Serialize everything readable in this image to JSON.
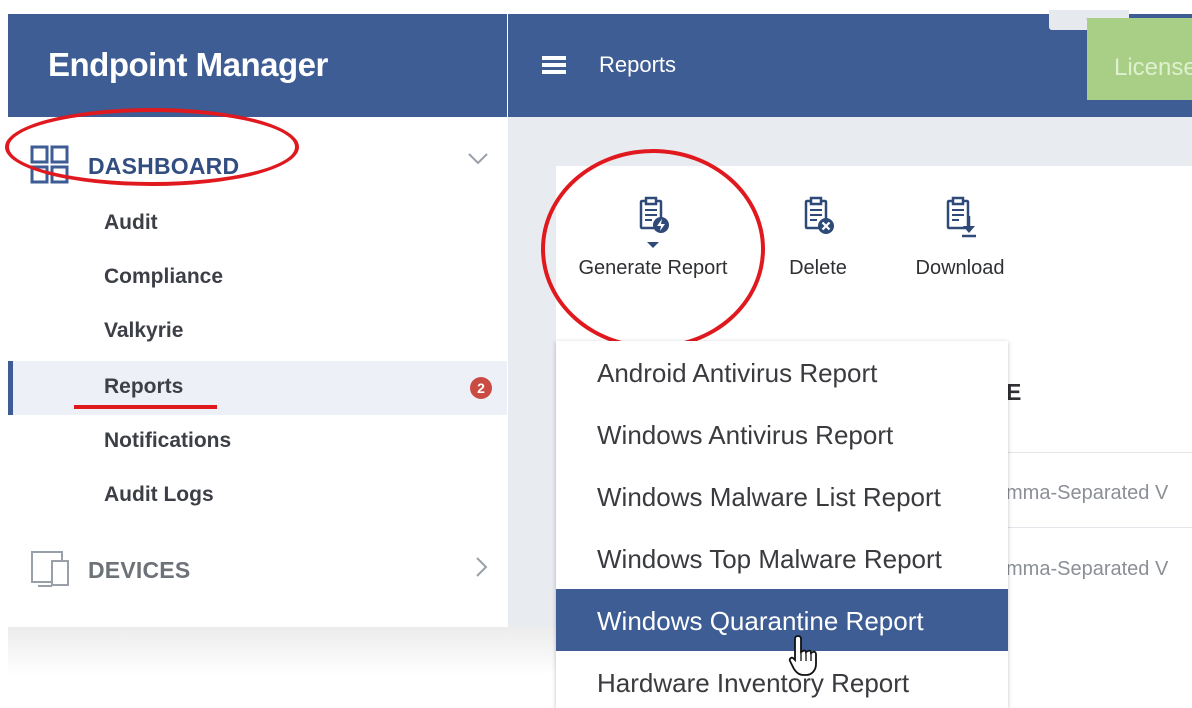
{
  "brand": {
    "title": "Endpoint Manager"
  },
  "header": {
    "title": "Reports",
    "license_button": "License",
    "collapse_icon": "chevron-down-icon"
  },
  "sidebar": {
    "dashboard": {
      "label": "DASHBOARD",
      "icon": "grid-icon"
    },
    "items": [
      {
        "label": "Audit"
      },
      {
        "label": "Compliance"
      },
      {
        "label": "Valkyrie"
      },
      {
        "label": "Reports",
        "badge": "2",
        "active": true
      },
      {
        "label": "Notifications"
      },
      {
        "label": "Audit Logs"
      }
    ],
    "devices": {
      "label": "DEVICES",
      "icon": "devices-icon"
    }
  },
  "toolbar": {
    "generate_label": "Generate Report",
    "delete_label": "Delete",
    "download_label": "Download"
  },
  "table": {
    "header_fragment": "E",
    "rows": [
      {
        "type_fragment": "mma-Separated V"
      },
      {
        "type_fragment": "mma-Separated V"
      }
    ]
  },
  "dropdown": {
    "items": [
      {
        "label": "Android Antivirus Report"
      },
      {
        "label": "Windows Antivirus Report"
      },
      {
        "label": "Windows Malware List Report"
      },
      {
        "label": "Windows Top Malware Report"
      },
      {
        "label": "Windows Quarantine Report",
        "hovered": true
      },
      {
        "label": "Hardware Inventory Report"
      }
    ]
  },
  "colors": {
    "primary": "#3d5d94",
    "annotation_red": "#e0191f",
    "badge": "#c94b43",
    "license_green": "#a9cf86"
  }
}
